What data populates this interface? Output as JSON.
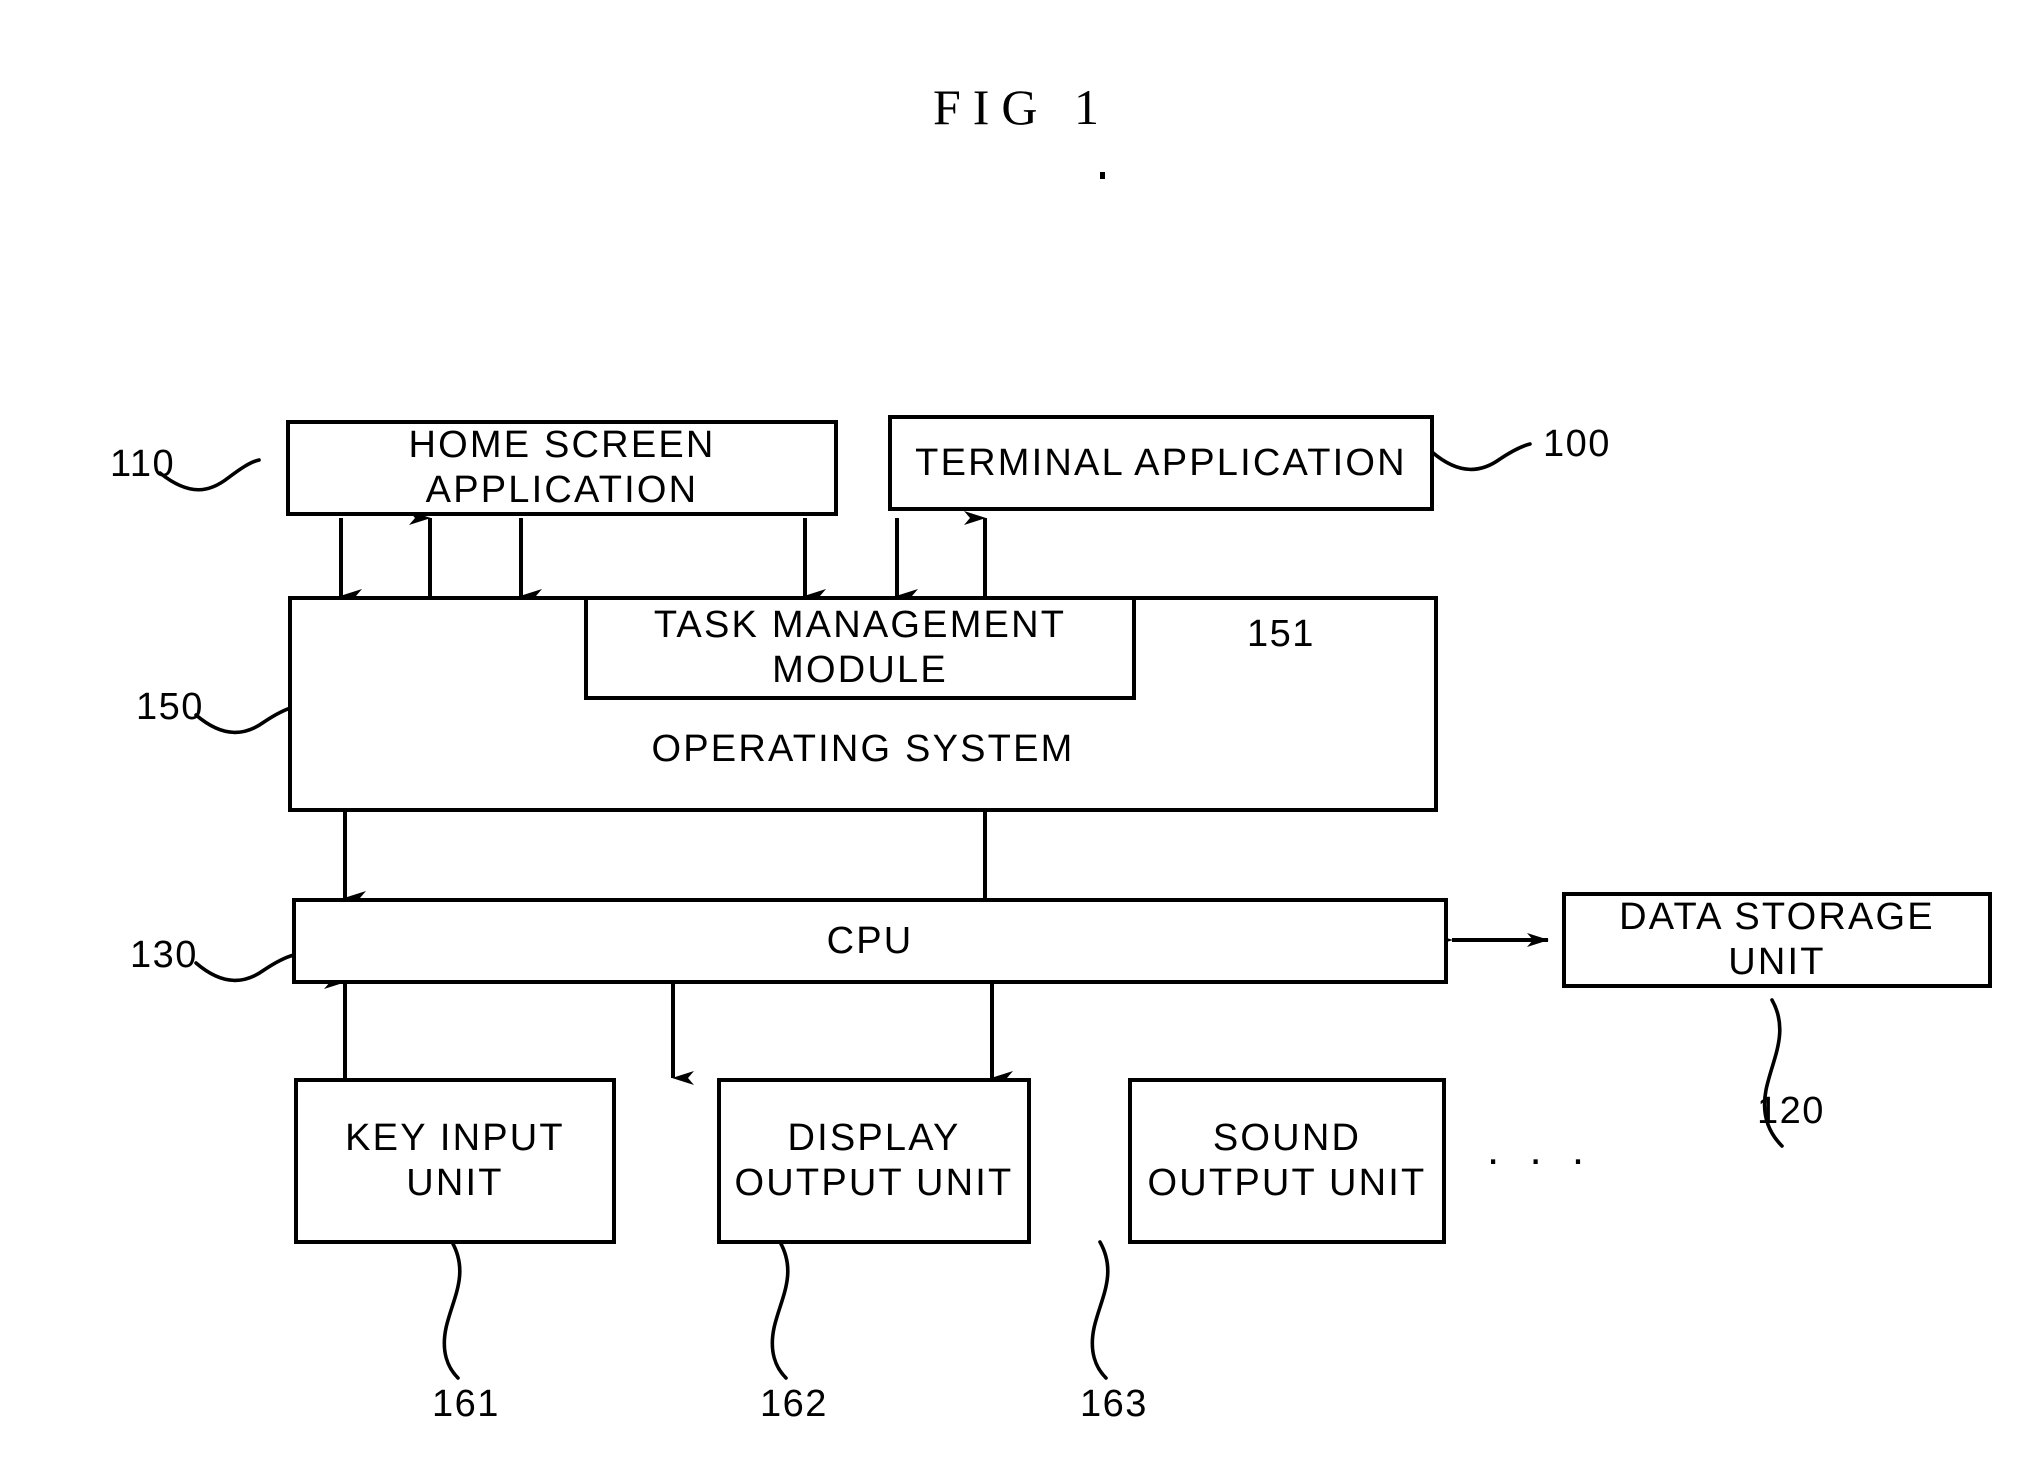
{
  "figure": {
    "title": "FIG 1",
    "type": "patent-block-diagram"
  },
  "boxes": {
    "home_screen_application": {
      "label": "HOME SCREEN APPLICATION",
      "ref": "110"
    },
    "terminal_application": {
      "label": "TERMINAL APPLICATION",
      "ref": "100"
    },
    "task_management_module": {
      "label": "TASK MANAGEMENT MODULE",
      "ref": "151"
    },
    "operating_system": {
      "label": "OPERATING SYSTEM",
      "ref": "150"
    },
    "cpu": {
      "label": "CPU",
      "ref": "130"
    },
    "data_storage_unit": {
      "label": "DATA STORAGE UNIT",
      "ref": "120"
    },
    "key_input_unit": {
      "label": "KEY INPUT\nUNIT",
      "ref": "161"
    },
    "display_output_unit": {
      "label": "DISPLAY\nOUTPUT UNIT",
      "ref": "162"
    },
    "sound_output_unit": {
      "label": "SOUND\nOUTPUT UNIT",
      "ref": "163"
    }
  },
  "refs": {
    "r110": "110",
    "r100": "100",
    "r151": "151",
    "r150": "150",
    "r130": "130",
    "r120": "120",
    "r161": "161",
    "r162": "162",
    "r163": "163"
  },
  "annotations": {
    "more_devices_ellipsis": ". . ."
  },
  "colors": {
    "ink": "#000000",
    "paper": "#ffffff"
  }
}
